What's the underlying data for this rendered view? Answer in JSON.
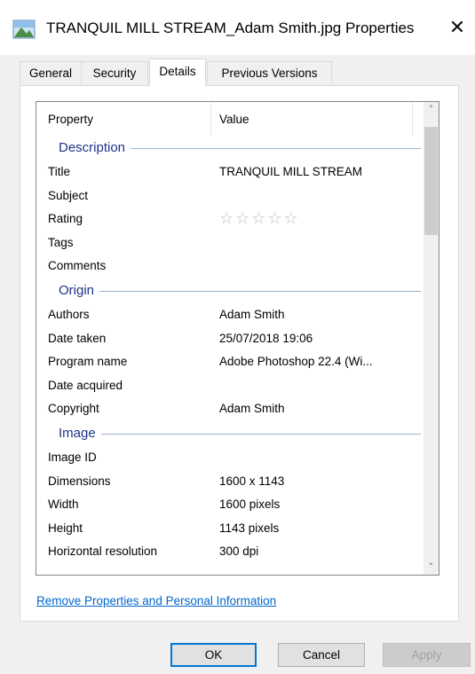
{
  "window": {
    "title": "TRANQUIL MILL STREAM_Adam Smith.jpg Properties",
    "close_glyph": "✕",
    "icon": "image-file-icon"
  },
  "tabs": [
    {
      "label": "General",
      "active": false
    },
    {
      "label": "Security",
      "active": false
    },
    {
      "label": "Details",
      "active": true
    },
    {
      "label": "Previous Versions",
      "active": false
    }
  ],
  "list": {
    "columns": {
      "property": "Property",
      "value": "Value"
    },
    "groups": [
      {
        "label": "Description",
        "rows": [
          {
            "key": "Title",
            "value": "TRANQUIL MILL STREAM"
          },
          {
            "key": "Subject",
            "value": ""
          },
          {
            "key": "Rating",
            "value": "☆☆☆☆☆"
          },
          {
            "key": "Tags",
            "value": ""
          },
          {
            "key": "Comments",
            "value": ""
          }
        ]
      },
      {
        "label": "Origin",
        "rows": [
          {
            "key": "Authors",
            "value": "Adam Smith"
          },
          {
            "key": "Date taken",
            "value": "25/07/2018 19:06"
          },
          {
            "key": "Program name",
            "value": "Adobe Photoshop 22.4 (Wi..."
          },
          {
            "key": "Date acquired",
            "value": ""
          },
          {
            "key": "Copyright",
            "value": "Adam Smith"
          }
        ]
      },
      {
        "label": "Image",
        "rows": [
          {
            "key": "Image ID",
            "value": ""
          },
          {
            "key": "Dimensions",
            "value": "1600 x 1143"
          },
          {
            "key": "Width",
            "value": "1600 pixels"
          },
          {
            "key": "Height",
            "value": "1143 pixels"
          },
          {
            "key": "Horizontal resolution",
            "value": "300 dpi"
          }
        ]
      }
    ],
    "rating_stars_filled": 0,
    "rating_stars_total": 5
  },
  "link": {
    "label": "Remove Properties and Personal Information"
  },
  "buttons": {
    "ok": "OK",
    "cancel": "Cancel",
    "apply": "Apply"
  },
  "colors": {
    "accent": "#0078d7",
    "group_label": "#1e3287",
    "link": "#0066cc"
  }
}
